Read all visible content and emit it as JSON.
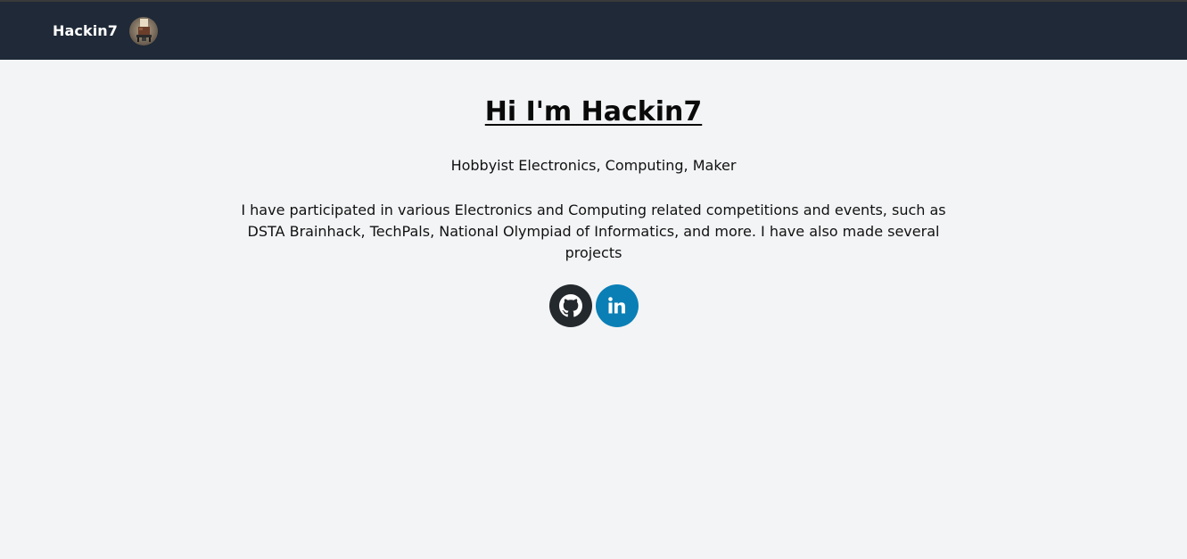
{
  "navbar": {
    "brand_name": "Hackin7",
    "avatar_alt": "Hackin7 avatar",
    "background": "#1f2937"
  },
  "hero": {
    "title": "Hi I'm Hackin7",
    "subtitle": "Hobbyist Electronics, Computing, Maker",
    "bio": "I have participated in various Electronics and Computing related competitions and events, such as DSTA Brainhack, TechPals, National Olympiad of Informatics, and more. I have also made several projects"
  },
  "socials": [
    {
      "name": "github",
      "icon": "github-icon",
      "color": "#24292e"
    },
    {
      "name": "linkedin",
      "icon": "linkedin-icon",
      "color": "#0a7fb5"
    }
  ],
  "colors": {
    "page_background": "#f3f4f6",
    "text": "#111111"
  }
}
